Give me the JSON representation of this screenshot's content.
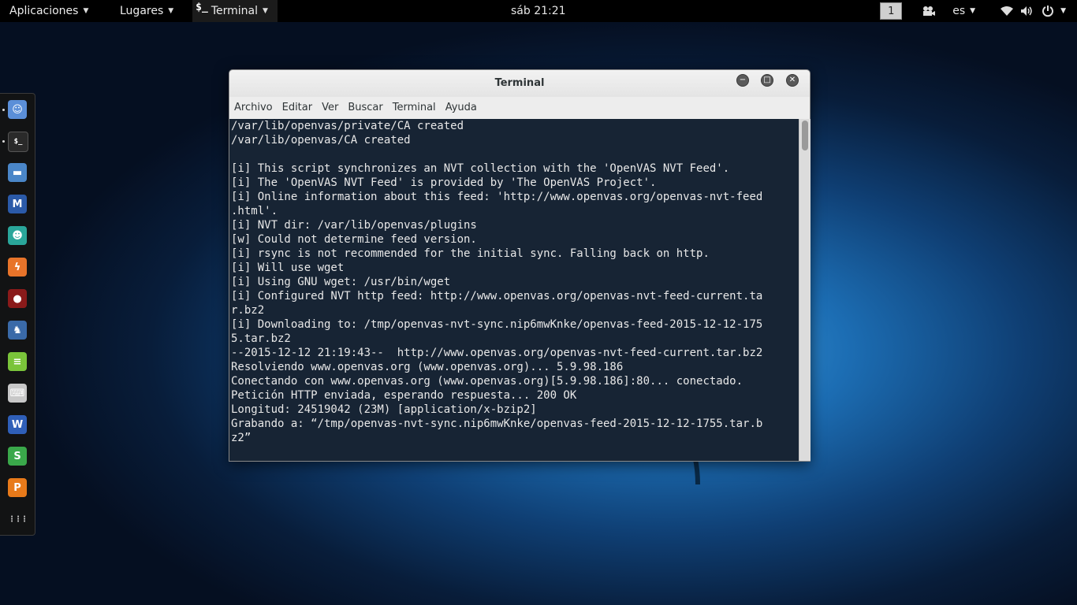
{
  "topbar": {
    "apps_label": "Aplicaciones",
    "places_label": "Lugares",
    "terminal_label": "Terminal",
    "terminal_glyph": "$_",
    "clock": "sáb 21:21",
    "workspace": "1",
    "language": "es"
  },
  "window": {
    "title": "Terminal",
    "minimize_glyph": "−",
    "maximize_glyph": "□",
    "close_glyph": "✕",
    "menu": [
      "Archivo",
      "Editar",
      "Ver",
      "Buscar",
      "Terminal",
      "Ayuda"
    ]
  },
  "terminal": {
    "lines": [
      "/var/lib/openvas/private/CA created",
      "/var/lib/openvas/CA created",
      "",
      "[i] This script synchronizes an NVT collection with the 'OpenVAS NVT Feed'.",
      "[i] The 'OpenVAS NVT Feed' is provided by 'The OpenVAS Project'.",
      "[i] Online information about this feed: 'http://www.openvas.org/openvas-nvt-feed",
      ".html'.",
      "[i] NVT dir: /var/lib/openvas/plugins",
      "[w] Could not determine feed version.",
      "[i] rsync is not recommended for the initial sync. Falling back on http.",
      "[i] Will use wget",
      "[i] Using GNU wget: /usr/bin/wget",
      "[i] Configured NVT http feed: http://www.openvas.org/openvas-nvt-feed-current.ta",
      "r.bz2",
      "[i] Downloading to: /tmp/openvas-nvt-sync.nip6mwKnke/openvas-feed-2015-12-12-175",
      "5.tar.bz2",
      "--2015-12-12 21:19:43--  http://www.openvas.org/openvas-nvt-feed-current.tar.bz2",
      "Resolviendo www.openvas.org (www.openvas.org)... 5.9.98.186",
      "Conectando con www.openvas.org (www.openvas.org)[5.9.98.186]:80... conectado.",
      "Petición HTTP enviada, esperando respuesta... 200 OK",
      "Longitud: 24519042 (23M) [application/x-bzip2]",
      "Grabando a: “/tmp/openvas-nvt-sync.nip6mwKnke/openvas-feed-2015-12-12-1755.tar.b",
      "z2”"
    ]
  },
  "dock": {
    "items": [
      {
        "icon": "chat-app-icon",
        "color": "#5b8fd8",
        "glyph": "☺"
      },
      {
        "icon": "terminal-icon",
        "color": "#2a2a2a",
        "glyph": "$_"
      },
      {
        "icon": "files-icon",
        "color": "#4a86c8",
        "glyph": "▬"
      },
      {
        "icon": "metasploit-icon",
        "color": "#2b5aa8",
        "glyph": "M"
      },
      {
        "icon": "armitage-icon",
        "color": "#2aa69a",
        "glyph": "☻"
      },
      {
        "icon": "burpsuite-icon",
        "color": "#e8742a",
        "glyph": "ϟ"
      },
      {
        "icon": "maltego-icon",
        "color": "#8a1a1a",
        "glyph": "●"
      },
      {
        "icon": "beef-icon",
        "color": "#3a6aa8",
        "glyph": "♞"
      },
      {
        "icon": "text-editor-icon",
        "color": "#7ac43a",
        "glyph": "≡"
      },
      {
        "icon": "keyboard-icon",
        "color": "#c8c8c8",
        "glyph": "⌨"
      },
      {
        "icon": "wps-writer-icon",
        "color": "#2f5fb8",
        "glyph": "W"
      },
      {
        "icon": "wps-spreadsheet-icon",
        "color": "#3aa84a",
        "glyph": "S"
      },
      {
        "icon": "wps-presentation-icon",
        "color": "#e87a1a",
        "glyph": "P"
      },
      {
        "icon": "app-grid-icon",
        "color": "transparent",
        "glyph": "⋮⋮⋮"
      }
    ]
  }
}
